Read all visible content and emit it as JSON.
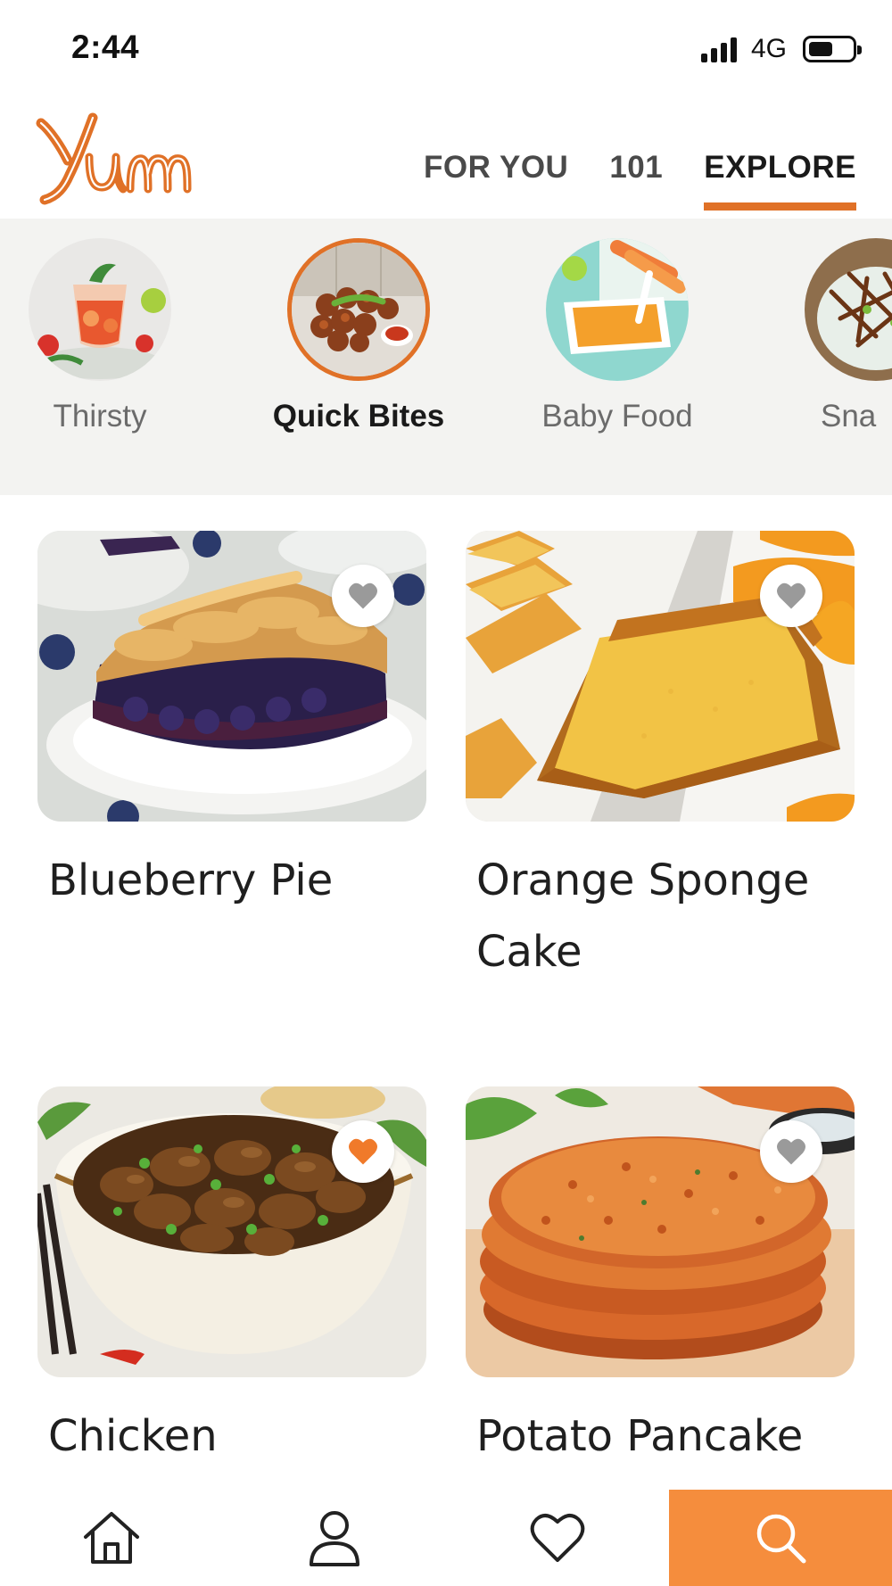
{
  "status_bar": {
    "time": "2:44",
    "network": "4G",
    "signal_bars": 4,
    "battery_level": 0.45
  },
  "header": {
    "logo_text": "Yum",
    "tabs": [
      {
        "label": "FOR YOU",
        "active": false
      },
      {
        "label": "101",
        "active": false
      },
      {
        "label": "EXPLORE",
        "active": true
      }
    ]
  },
  "categories": [
    {
      "label": "Thirsty",
      "selected": false,
      "icon": "drink-photo"
    },
    {
      "label": "Quick Bites",
      "selected": true,
      "icon": "fritters-photo"
    },
    {
      "label": "Baby Food",
      "selected": false,
      "icon": "puree-photo"
    },
    {
      "label": "Sna",
      "selected": false,
      "icon": "snack-photo"
    }
  ],
  "recipes": [
    {
      "title": "Blueberry Pie",
      "favorited": false
    },
    {
      "title": "Orange Sponge Cake",
      "favorited": false
    },
    {
      "title": "Chicken Mushroom Stir",
      "favorited": true
    },
    {
      "title": "Potato Pancake",
      "favorited": false
    }
  ],
  "bottom_nav": [
    {
      "icon": "home-icon"
    },
    {
      "icon": "profile-icon"
    },
    {
      "icon": "heart-icon"
    },
    {
      "icon": "search-icon",
      "active": true
    }
  ],
  "colors": {
    "accent": "#e07127",
    "search_bg": "#f58d3d",
    "category_bg": "#f3f3f1",
    "fav_active": "#f07a2a",
    "fav_inactive": "#9a9a9a"
  }
}
